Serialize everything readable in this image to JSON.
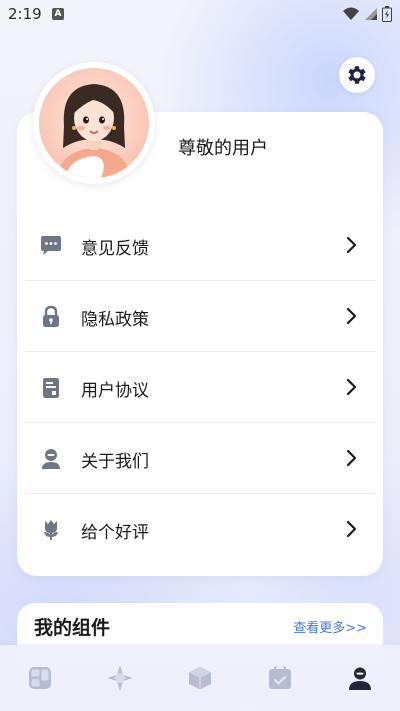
{
  "status_bar": {
    "time": "2:19",
    "notification_badge": "A",
    "icons": [
      "wifi-icon",
      "signal-icon",
      "battery-icon"
    ]
  },
  "header": {
    "settings_icon": "gear-icon"
  },
  "profile": {
    "username": "尊敬的用户",
    "avatar": "avatar-girl"
  },
  "menu": {
    "items": [
      {
        "label": "意见反馈",
        "icon": "chat-bubble-icon"
      },
      {
        "label": "隐私政策",
        "icon": "lock-icon"
      },
      {
        "label": "用户协议",
        "icon": "document-icon"
      },
      {
        "label": "关于我们",
        "icon": "person-icon"
      },
      {
        "label": "给个好评",
        "icon": "flower-icon"
      }
    ]
  },
  "widgets": {
    "title": "我的组件",
    "more": "查看更多>>"
  },
  "tabbar": {
    "tabs": [
      {
        "icon": "grid-apps-icon",
        "active": false
      },
      {
        "icon": "compass-icon",
        "active": false
      },
      {
        "icon": "cube-icon",
        "active": false
      },
      {
        "icon": "calendar-check-icon",
        "active": false
      },
      {
        "icon": "profile-icon",
        "active": true
      }
    ]
  },
  "colors": {
    "accent": "#4a78d6",
    "icon_gray": "#6f7685",
    "tab_inactive": "#b7bdd0",
    "tab_active": "#22263a"
  }
}
